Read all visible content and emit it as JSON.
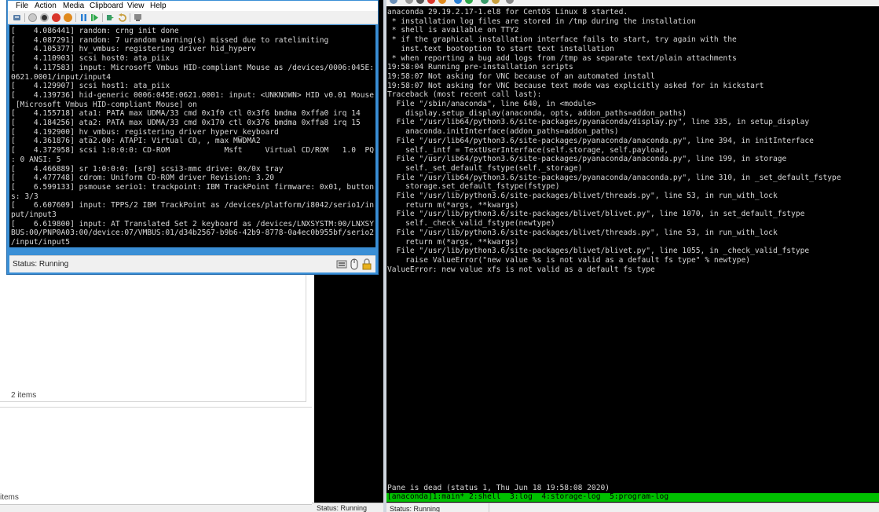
{
  "front_window": {
    "menu": [
      "File",
      "Action",
      "Media",
      "Clipboard",
      "View",
      "Help"
    ],
    "status": "Status: Running",
    "console_lines": [
      "[    4.086441] random: crng init done",
      "[    4.087291] random: 7 urandom warning(s) missed due to ratelimiting",
      "[    4.105377] hv_vmbus: registering driver hid_hyperv",
      "[    4.110903] scsi host0: ata_piix",
      "[    4.117583] input: Microsoft Vmbus HID-compliant Mouse as /devices/0006:045E:",
      "0621.0001/input/input4",
      "[    4.129907] scsi host1: ata_piix",
      "[    4.139736] hid-generic 0006:045E:0621.0001: input: <UNKNOWN> HID v0.01 Mouse",
      " [Microsoft Vmbus HID-compliant Mouse] on",
      "[    4.155718] ata1: PATA max UDMA/33 cmd 0x1f0 ctl 0x3f6 bmdma 0xffa0 irq 14",
      "[    4.184256] ata2: PATA max UDMA/33 cmd 0x170 ctl 0x376 bmdma 0xffa8 irq 15",
      "[    4.192900] hv_vmbus: registering driver hyperv_keyboard",
      "[    4.361876] ata2.00: ATAPI: Virtual CD, , max MWDMA2",
      "[    4.372958] scsi 1:0:0:0: CD-ROM            Msft     Virtual CD/ROM   1.0  PQ",
      ": 0 ANSI: 5",
      "[    4.466889] sr 1:0:0:0: [sr0] scsi3-mmc drive: 0x/0x tray",
      "[    4.477748] cdrom: Uniform CD-ROM driver Revision: 3.20",
      "[    6.599133] psmouse serio1: trackpoint: IBM TrackPoint firmware: 0x01, button",
      "s: 3/3",
      "[    6.607609] input: TPPS/2 IBM TrackPoint as /devices/platform/i8042/serio1/in",
      "put/input3",
      "[    6.619800] input: AT Translated Set 2 keyboard as /devices/LNXSYSTM:00/LNXSY",
      "BUS:00/PNP0A03:00/device:07/VMBUS:01/d34b2567-b9b6-42b9-8778-0a4ec0b955bf/serio2",
      "/input/input5"
    ]
  },
  "right_window": {
    "console_lines": [
      "anaconda 29.19.2.17-1.el8 for CentOS Linux 8 started.",
      " * installation log files are stored in /tmp during the installation",
      " * shell is available on TTY2",
      " * if the graphical installation interface fails to start, try again with the",
      "   inst.text bootoption to start text installation",
      " * when reporting a bug add logs from /tmp as separate text/plain attachments",
      "19:58:04 Running pre-installation scripts",
      "19:58:07 Not asking for VNC because of an automated install",
      "19:58:07 Not asking for VNC because text mode was explicitly asked for in kickstart",
      "Traceback (most recent call last):",
      "  File \"/sbin/anaconda\", line 640, in <module>",
      "    display.setup_display(anaconda, opts, addon_paths=addon_paths)",
      "  File \"/usr/lib64/python3.6/site-packages/pyanaconda/display.py\", line 335, in setup_display",
      "    anaconda.initInterface(addon_paths=addon_paths)",
      "  File \"/usr/lib64/python3.6/site-packages/pyanaconda/anaconda.py\", line 394, in initInterface",
      "    self._intf = TextUserInterface(self.storage, self.payload,",
      "  File \"/usr/lib64/python3.6/site-packages/pyanaconda/anaconda.py\", line 199, in storage",
      "    self._set_default_fstype(self._storage)",
      "  File \"/usr/lib64/python3.6/site-packages/pyanaconda/anaconda.py\", line 310, in _set_default_fstype",
      "    storage.set_default_fstype(fstype)",
      "  File \"/usr/lib/python3.6/site-packages/blivet/threads.py\", line 53, in run_with_lock",
      "    return m(*args, **kwargs)",
      "  File \"/usr/lib/python3.6/site-packages/blivet/blivet.py\", line 1070, in set_default_fstype",
      "    self._check_valid_fstype(newtype)",
      "  File \"/usr/lib/python3.6/site-packages/blivet/threads.py\", line 53, in run_with_lock",
      "    return m(*args, **kwargs)",
      "  File \"/usr/lib/python3.6/site-packages/blivet/blivet.py\", line 1055, in _check_valid_fstype",
      "    raise ValueError(\"new value %s is not valid as a default fs type\" % newtype)",
      "ValueError: new value xfs is not valid as a default fs type"
    ],
    "pane_dead": "Pane is dead (status 1, Thu Jun 18 19:58:08 2020)",
    "tmux_bar": "[anaconda]1:main* 2:shell  3:log  4:storage-log  5:program-log",
    "status": "Status: Running"
  },
  "middle_status": "Status: Running",
  "background_window": {
    "items_top": "2 items",
    "items_bottom": "items"
  },
  "colors": {
    "window_frame": "#3a8fd6",
    "tmux_green": "#00c000",
    "console_text": "#d8d8d8"
  }
}
